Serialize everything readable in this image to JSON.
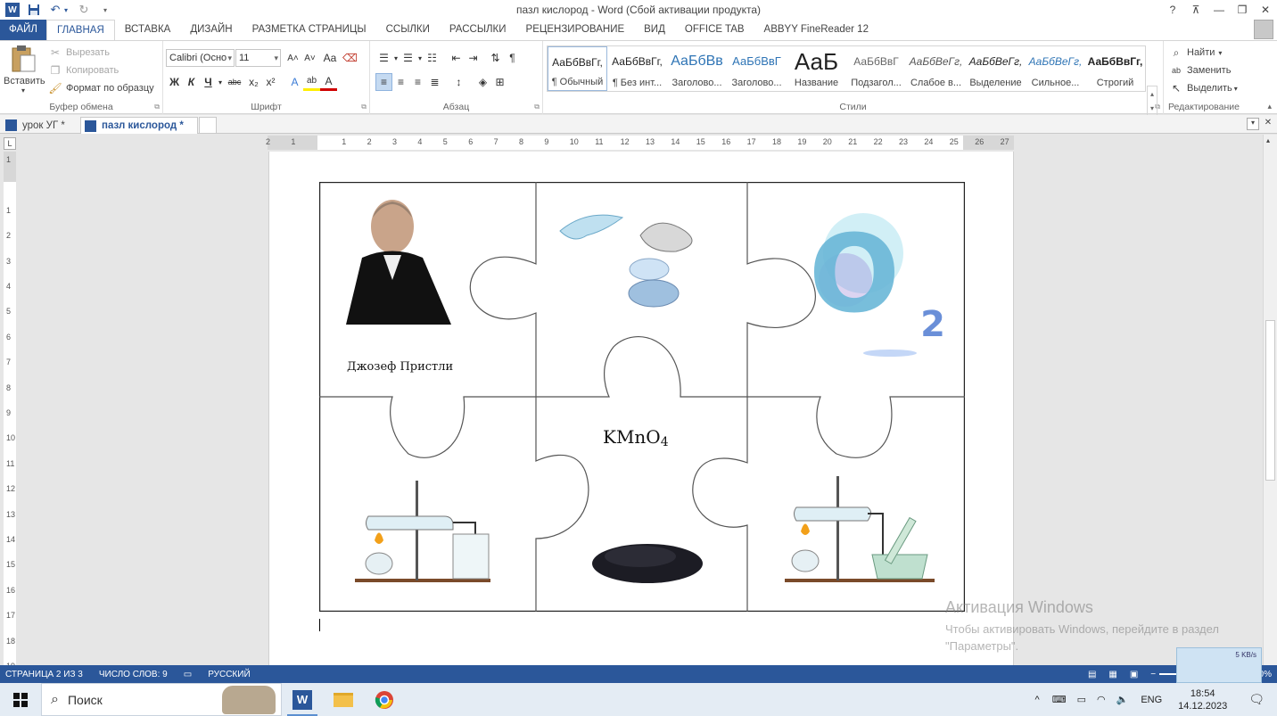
{
  "titlebar": {
    "title": "пазл кислород - Word (Сбой активации продукта)",
    "help": "?",
    "minimize": "—",
    "restore": "❐",
    "close": "✕"
  },
  "tabs": [
    {
      "label": "ФАЙЛ"
    },
    {
      "label": "ГЛАВНАЯ"
    },
    {
      "label": "ВСТАВКА"
    },
    {
      "label": "ДИЗАЙН"
    },
    {
      "label": "РАЗМЕТКА СТРАНИЦЫ"
    },
    {
      "label": "ССЫЛКИ"
    },
    {
      "label": "РАССЫЛКИ"
    },
    {
      "label": "РЕЦЕНЗИРОВАНИЕ"
    },
    {
      "label": "ВИД"
    },
    {
      "label": "OFFICE TAB"
    },
    {
      "label": "ABBYY FineReader 12"
    }
  ],
  "clipboard": {
    "paste": "Вставить",
    "cut": "Вырезать",
    "copy": "Копировать",
    "format_painter": "Формат по образцу",
    "label": "Буфер обмена"
  },
  "font": {
    "name": "Calibri (Осно",
    "size": "11",
    "label": "Шрифт",
    "bold": "Ж",
    "italic": "К",
    "underline": "Ч",
    "strike": "abc",
    "sub": "x₂",
    "sup": "x²",
    "grow": "A˄",
    "shrink": "A˅",
    "case": "Aa"
  },
  "paragraph": {
    "label": "Абзац"
  },
  "styles": {
    "label": "Стили",
    "items": [
      {
        "sample": "АаБбВвГг,",
        "name": "¶ Обычный"
      },
      {
        "sample": "АаБбВвГг,",
        "name": "¶ Без инт..."
      },
      {
        "sample": "АаБбВв",
        "name": "Заголово..."
      },
      {
        "sample": "АаБбВвГ",
        "name": "Заголово..."
      },
      {
        "sample": "АаБ",
        "name": "Название"
      },
      {
        "sample": "АаБбВвГ",
        "name": "Подзагол..."
      },
      {
        "sample": "АаБбВеГг,",
        "name": "Слабое в..."
      },
      {
        "sample": "АаБбВеГг,",
        "name": "Выделение"
      },
      {
        "sample": "АаБбВеГг,",
        "name": "Сильное..."
      },
      {
        "sample": "АаБбВвГг,",
        "name": "Строгий"
      }
    ]
  },
  "editing": {
    "find": "Найти",
    "replace": "Заменить",
    "select": "Выделить",
    "label": "Редактирование"
  },
  "doctabs": [
    {
      "label": "урок УГ *"
    },
    {
      "label": "пазл кислород *"
    }
  ],
  "ruler": {
    "corner": "L",
    "h_marks": [
      "2",
      "1",
      "",
      "1",
      "2",
      "3",
      "4",
      "5",
      "6",
      "7",
      "8",
      "9",
      "10",
      "11",
      "12",
      "13",
      "14",
      "15",
      "16",
      "17",
      "18",
      "19",
      "20",
      "21",
      "22",
      "23",
      "24",
      "25",
      "26",
      "27"
    ],
    "v_marks": [
      "1",
      "",
      "1",
      "2",
      "3",
      "4",
      "5",
      "6",
      "7",
      "8",
      "9",
      "10",
      "11",
      "12",
      "13",
      "14",
      "15",
      "16",
      "17",
      "18",
      "19"
    ]
  },
  "document": {
    "caption_priestley": "Джозеф Пристли",
    "formula_main": "KMnO",
    "formula_sub": "4",
    "o2_letter": "O",
    "o2_sub": "2"
  },
  "watermark": {
    "title": "Активация Windows",
    "line1": "Чтобы активировать Windows, перейдите в раздел",
    "line2": "\"Параметры\"."
  },
  "statusbar": {
    "page": "СТРАНИЦА 2 ИЗ 3",
    "words": "ЧИСЛО СЛОВ: 9",
    "language": "РУССКИЙ",
    "zoom": "90%",
    "net": "5 KB/s"
  },
  "taskbar": {
    "search": "Поиск",
    "lang": "ENG",
    "time": "18:54",
    "date": "14.12.2023"
  },
  "colors": {
    "word_blue": "#2b579a",
    "status_blue": "#2b579a",
    "taskbar": "#e4ecf4"
  }
}
